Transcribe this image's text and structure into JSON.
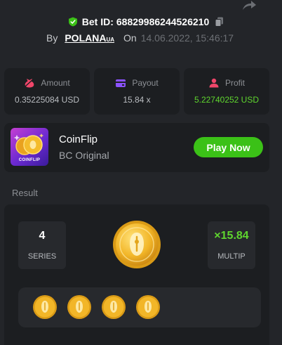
{
  "bet": {
    "id_label": "Bet ID:",
    "id_value": "68829986244526210",
    "by_label": "By",
    "user": "POLANA",
    "user_suffix": "UA",
    "on_label": "On",
    "date": "14.06.2022, 15:46:17"
  },
  "stats": [
    {
      "label": "Amount",
      "value": "0.35225084 USD",
      "icon": "money-bag-icon",
      "color": "#f0466a"
    },
    {
      "label": "Payout",
      "value": "15.84 x",
      "icon": "wallet-card-icon",
      "color": "#8b52ff"
    },
    {
      "label": "Profit",
      "value": "5.22740252 USD",
      "icon": "user-profit-icon",
      "color": "#f0466a",
      "value_color": "#5fd62e"
    }
  ],
  "game": {
    "thumb_caption": "COINFLIP",
    "name": "CoinFlip",
    "provider": "BC Original",
    "play_label": "Play Now"
  },
  "result": {
    "label": "Result",
    "series_value": "4",
    "series_label": "SERIES",
    "multiplier": "×15.84",
    "multiplier_label": "MULTIP",
    "coins_count": 4
  },
  "colors": {
    "accent_green": "#3bc117",
    "profit_green": "#5fd62e",
    "coin_gold": "#f2b628"
  }
}
